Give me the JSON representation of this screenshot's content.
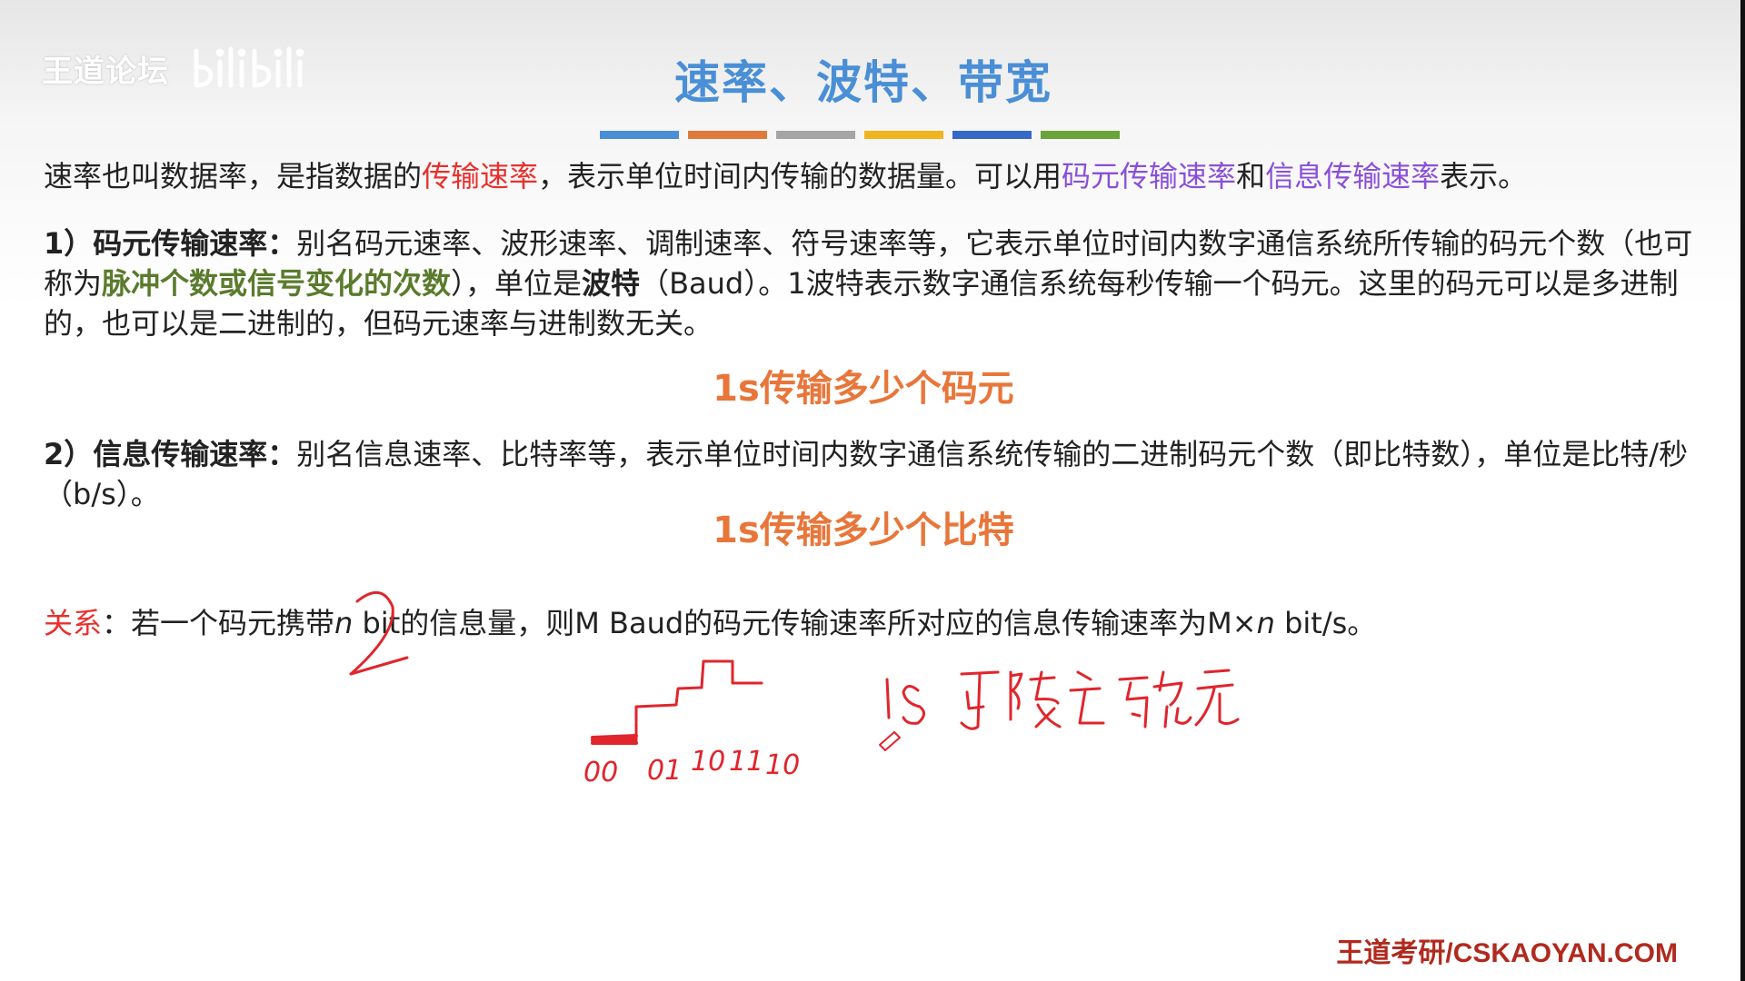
{
  "watermark": {
    "text": "王道论坛"
  },
  "slide": {
    "title": "速率、波特、带宽",
    "intro": {
      "part1": "速率也叫数据率，是指数据的",
      "highlight1": "传输速率",
      "part2": "，表示单位时间内传输的数据量。可以用",
      "highlight2": "码元传输速率",
      "part3": "和",
      "highlight3": "信息传输速率",
      "part4": "表示。"
    },
    "item1": {
      "label": "1）码元传输速率：",
      "part1": "别名码元速率、波形速率、调制速率、符号速率等，它表示单位时间内数字通信系统所传输的码元个数（也可称为",
      "highlight": "脉冲个数或信号变化的次数",
      "part2": "），单位是",
      "unit": "波特",
      "part3": "（Baud）。1波特表示数字通信系统每秒传输一个码元。这里的码元可以是多进制的，也可以是二进制的，但码元速率与进制数无关。"
    },
    "emphasis1": "1s传输多少个码元",
    "item2": {
      "label": "2）信息传输速率：",
      "text": "别名信息速率、比特率等，表示单位时间内数字通信系统传输的二进制码元个数（即比特数），单位是比特/秒（b/s）。"
    },
    "emphasis2": "1s传输多少个比特",
    "relation": {
      "label": "关系",
      "part1": "：若一个码元携带",
      "var1": "n",
      "part2": " bit的信息量，则M Baud的码元传输速率所对应的信息传输速率为M×",
      "var2": "n",
      "part3": " bit/s。"
    },
    "footer": "王道考研/CSKAOYAN.COM"
  },
  "colors": {
    "title": "#4a8fd6",
    "red": "#e8302c",
    "purple": "#8a4fd8",
    "green": "#5a7b2c",
    "orange": "#e8763a",
    "footer": "#b02a1e",
    "ink_red": "#e0252c",
    "bar": [
      "#4a8fd6",
      "#e07a3c",
      "#a5a5a5",
      "#f0b51e",
      "#3568c7",
      "#6aa43a"
    ]
  },
  "annotations": {
    "handwritten_digit": "2",
    "waveform_labels": [
      "00",
      "01",
      "10",
      "11",
      "10"
    ],
    "handwritten_note": "1S 可传 5 码元"
  }
}
